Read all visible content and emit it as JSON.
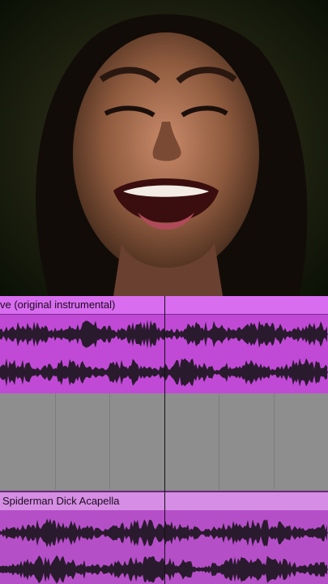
{
  "video": {
    "description_icon": "performer-video"
  },
  "tracks": [
    {
      "clip_label": "ve (original instrumental)",
      "color": "#c04ad6"
    },
    {
      "clip_label": "Spiderman Dick Acapella",
      "color": "#b54fc8"
    }
  ],
  "colors": {
    "waveform": "#2a1a2e",
    "playhead": "#111111",
    "empty_track": "#8e8e8e"
  }
}
